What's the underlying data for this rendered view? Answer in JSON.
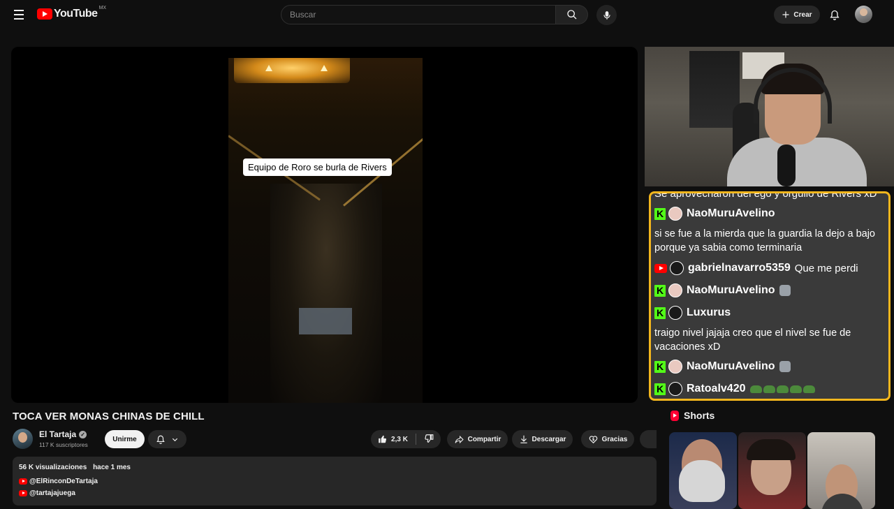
{
  "header": {
    "logo_text": "YouTube",
    "region": "MX",
    "search_placeholder": "Buscar",
    "create_label": "Crear"
  },
  "player": {
    "caption": "Equipo de Roro se burla de Rivers"
  },
  "chat": {
    "top_partial": "Se aprovecharon del ego y orgullo de Rivers xD",
    "messages": [
      {
        "platform": "kick",
        "user": "NaoMuruAvelino",
        "text": ""
      },
      {
        "platform": "text",
        "user": "",
        "text": "si se fue a la mierda que la guardia la dejo a bajo porque ya sabia como terminaria"
      },
      {
        "platform": "youtube",
        "user": "gabrielnavarro5359",
        "text": "Que me perdi"
      },
      {
        "platform": "kick",
        "user": "NaoMuruAvelino",
        "text": ""
      },
      {
        "platform": "kick",
        "user": "Luxurus",
        "text": ""
      },
      {
        "platform": "text",
        "user": "",
        "text": "traigo nivel jajaja creo que el nivel se fue de vacaciones xD"
      },
      {
        "platform": "kick",
        "user": "NaoMuruAvelino",
        "text": ""
      },
      {
        "platform": "kick",
        "user": "Ratoalv420",
        "text": ""
      }
    ],
    "border_color": "#f3b61d",
    "kick_color": "#53fc18"
  },
  "video": {
    "title": "TOCA VER MONAS CHINAS DE CHILL",
    "channel_name": "El Tartaja",
    "subscribers": "117 K suscriptores",
    "join_label": "Unirme",
    "likes": "2,3 K",
    "share_label": "Compartir",
    "download_label": "Descargar",
    "thanks_label": "Gracias"
  },
  "description": {
    "views": "56 K visualizaciones",
    "date": "hace 1 mes",
    "links": [
      "@ElRinconDeTartaja",
      "@tartajajuega"
    ]
  },
  "shorts": {
    "title": "Shorts"
  },
  "colors": {
    "background": "#0f0f0f",
    "brand_red": "#ff0000",
    "chip": "#272727"
  }
}
